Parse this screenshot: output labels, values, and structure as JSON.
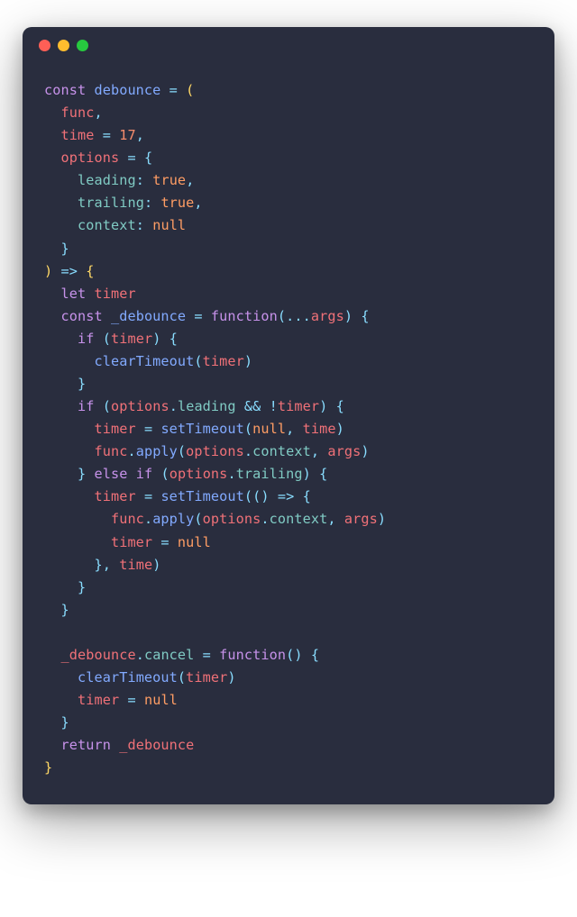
{
  "window": {
    "dots": [
      "red",
      "yellow",
      "green"
    ]
  },
  "code": {
    "tokens": [
      [
        [
          "kw",
          "const"
        ],
        [
          "",
          " "
        ],
        [
          "fn",
          "debounce"
        ],
        [
          "",
          " "
        ],
        [
          "op",
          "="
        ],
        [
          "",
          " "
        ],
        [
          "p",
          "("
        ]
      ],
      [
        [
          "",
          "  "
        ],
        [
          "id",
          "func"
        ],
        [
          "op",
          ","
        ]
      ],
      [
        [
          "",
          "  "
        ],
        [
          "id",
          "time"
        ],
        [
          "",
          " "
        ],
        [
          "op",
          "="
        ],
        [
          "",
          " "
        ],
        [
          "num",
          "17"
        ],
        [
          "op",
          ","
        ]
      ],
      [
        [
          "",
          "  "
        ],
        [
          "id",
          "options"
        ],
        [
          "",
          " "
        ],
        [
          "op",
          "="
        ],
        [
          "",
          " "
        ],
        [
          "op",
          "{"
        ]
      ],
      [
        [
          "",
          "    "
        ],
        [
          "prop",
          "leading"
        ],
        [
          "op",
          ":"
        ],
        [
          "",
          " "
        ],
        [
          "bool",
          "true"
        ],
        [
          "op",
          ","
        ]
      ],
      [
        [
          "",
          "    "
        ],
        [
          "prop",
          "trailing"
        ],
        [
          "op",
          ":"
        ],
        [
          "",
          " "
        ],
        [
          "bool",
          "true"
        ],
        [
          "op",
          ","
        ]
      ],
      [
        [
          "",
          "    "
        ],
        [
          "prop",
          "context"
        ],
        [
          "op",
          ":"
        ],
        [
          "",
          " "
        ],
        [
          "bool",
          "null"
        ]
      ],
      [
        [
          "",
          "  "
        ],
        [
          "op",
          "}"
        ]
      ],
      [
        [
          "p",
          ")"
        ],
        [
          "",
          " "
        ],
        [
          "op",
          "=>"
        ],
        [
          "",
          " "
        ],
        [
          "p",
          "{"
        ]
      ],
      [
        [
          "",
          "  "
        ],
        [
          "kw",
          "let"
        ],
        [
          "",
          " "
        ],
        [
          "id",
          "timer"
        ]
      ],
      [
        [
          "",
          "  "
        ],
        [
          "kw",
          "const"
        ],
        [
          "",
          " "
        ],
        [
          "fn",
          "_debounce"
        ],
        [
          "",
          " "
        ],
        [
          "op",
          "="
        ],
        [
          "",
          " "
        ],
        [
          "kw",
          "function"
        ],
        [
          "op",
          "("
        ],
        [
          "op",
          "..."
        ],
        [
          "id",
          "args"
        ],
        [
          "op",
          ")"
        ],
        [
          "",
          " "
        ],
        [
          "op",
          "{"
        ]
      ],
      [
        [
          "",
          "    "
        ],
        [
          "kw",
          "if"
        ],
        [
          "",
          " "
        ],
        [
          "op",
          "("
        ],
        [
          "id",
          "timer"
        ],
        [
          "op",
          ")"
        ],
        [
          "",
          " "
        ],
        [
          "op",
          "{"
        ]
      ],
      [
        [
          "",
          "      "
        ],
        [
          "fn",
          "clearTimeout"
        ],
        [
          "op",
          "("
        ],
        [
          "id",
          "timer"
        ],
        [
          "op",
          ")"
        ]
      ],
      [
        [
          "",
          "    "
        ],
        [
          "op",
          "}"
        ]
      ],
      [
        [
          "",
          "    "
        ],
        [
          "kw",
          "if"
        ],
        [
          "",
          " "
        ],
        [
          "op",
          "("
        ],
        [
          "id",
          "options"
        ],
        [
          "op",
          "."
        ],
        [
          "prop",
          "leading"
        ],
        [
          "",
          " "
        ],
        [
          "op",
          "&&"
        ],
        [
          "",
          " "
        ],
        [
          "op",
          "!"
        ],
        [
          "id",
          "timer"
        ],
        [
          "op",
          ")"
        ],
        [
          "",
          " "
        ],
        [
          "op",
          "{"
        ]
      ],
      [
        [
          "",
          "      "
        ],
        [
          "id",
          "timer"
        ],
        [
          "",
          " "
        ],
        [
          "op",
          "="
        ],
        [
          "",
          " "
        ],
        [
          "fn",
          "setTimeout"
        ],
        [
          "op",
          "("
        ],
        [
          "bool",
          "null"
        ],
        [
          "op",
          ","
        ],
        [
          "",
          " "
        ],
        [
          "id",
          "time"
        ],
        [
          "op",
          ")"
        ]
      ],
      [
        [
          "",
          "      "
        ],
        [
          "id",
          "func"
        ],
        [
          "op",
          "."
        ],
        [
          "fn",
          "apply"
        ],
        [
          "op",
          "("
        ],
        [
          "id",
          "options"
        ],
        [
          "op",
          "."
        ],
        [
          "prop",
          "context"
        ],
        [
          "op",
          ","
        ],
        [
          "",
          " "
        ],
        [
          "id",
          "args"
        ],
        [
          "op",
          ")"
        ]
      ],
      [
        [
          "",
          "    "
        ],
        [
          "op",
          "}"
        ],
        [
          "",
          " "
        ],
        [
          "kw",
          "else"
        ],
        [
          "",
          " "
        ],
        [
          "kw",
          "if"
        ],
        [
          "",
          " "
        ],
        [
          "op",
          "("
        ],
        [
          "id",
          "options"
        ],
        [
          "op",
          "."
        ],
        [
          "prop",
          "trailing"
        ],
        [
          "op",
          ")"
        ],
        [
          "",
          " "
        ],
        [
          "op",
          "{"
        ]
      ],
      [
        [
          "",
          "      "
        ],
        [
          "id",
          "timer"
        ],
        [
          "",
          " "
        ],
        [
          "op",
          "="
        ],
        [
          "",
          " "
        ],
        [
          "fn",
          "setTimeout"
        ],
        [
          "op",
          "(("
        ],
        [
          "op",
          ")"
        ],
        [
          "",
          " "
        ],
        [
          "op",
          "=>"
        ],
        [
          "",
          " "
        ],
        [
          "op",
          "{"
        ]
      ],
      [
        [
          "",
          "        "
        ],
        [
          "id",
          "func"
        ],
        [
          "op",
          "."
        ],
        [
          "fn",
          "apply"
        ],
        [
          "op",
          "("
        ],
        [
          "id",
          "options"
        ],
        [
          "op",
          "."
        ],
        [
          "prop",
          "context"
        ],
        [
          "op",
          ","
        ],
        [
          "",
          " "
        ],
        [
          "id",
          "args"
        ],
        [
          "op",
          ")"
        ]
      ],
      [
        [
          "",
          "        "
        ],
        [
          "id",
          "timer"
        ],
        [
          "",
          " "
        ],
        [
          "op",
          "="
        ],
        [
          "",
          " "
        ],
        [
          "bool",
          "null"
        ]
      ],
      [
        [
          "",
          "      "
        ],
        [
          "op",
          "},"
        ],
        [
          "",
          " "
        ],
        [
          "id",
          "time"
        ],
        [
          "op",
          ")"
        ]
      ],
      [
        [
          "",
          "    "
        ],
        [
          "op",
          "}"
        ]
      ],
      [
        [
          "",
          "  "
        ],
        [
          "op",
          "}"
        ]
      ],
      [
        [
          "",
          ""
        ]
      ],
      [
        [
          "",
          "  "
        ],
        [
          "id",
          "_debounce"
        ],
        [
          "op",
          "."
        ],
        [
          "prop",
          "cancel"
        ],
        [
          "",
          " "
        ],
        [
          "op",
          "="
        ],
        [
          "",
          " "
        ],
        [
          "kw",
          "function"
        ],
        [
          "op",
          "()"
        ],
        [
          "",
          " "
        ],
        [
          "op",
          "{"
        ]
      ],
      [
        [
          "",
          "    "
        ],
        [
          "fn",
          "clearTimeout"
        ],
        [
          "op",
          "("
        ],
        [
          "id",
          "timer"
        ],
        [
          "op",
          ")"
        ]
      ],
      [
        [
          "",
          "    "
        ],
        [
          "id",
          "timer"
        ],
        [
          "",
          " "
        ],
        [
          "op",
          "="
        ],
        [
          "",
          " "
        ],
        [
          "bool",
          "null"
        ]
      ],
      [
        [
          "",
          "  "
        ],
        [
          "op",
          "}"
        ]
      ],
      [
        [
          "",
          "  "
        ],
        [
          "kw",
          "return"
        ],
        [
          "",
          " "
        ],
        [
          "id",
          "_debounce"
        ]
      ],
      [
        [
          "p",
          "}"
        ]
      ]
    ]
  }
}
